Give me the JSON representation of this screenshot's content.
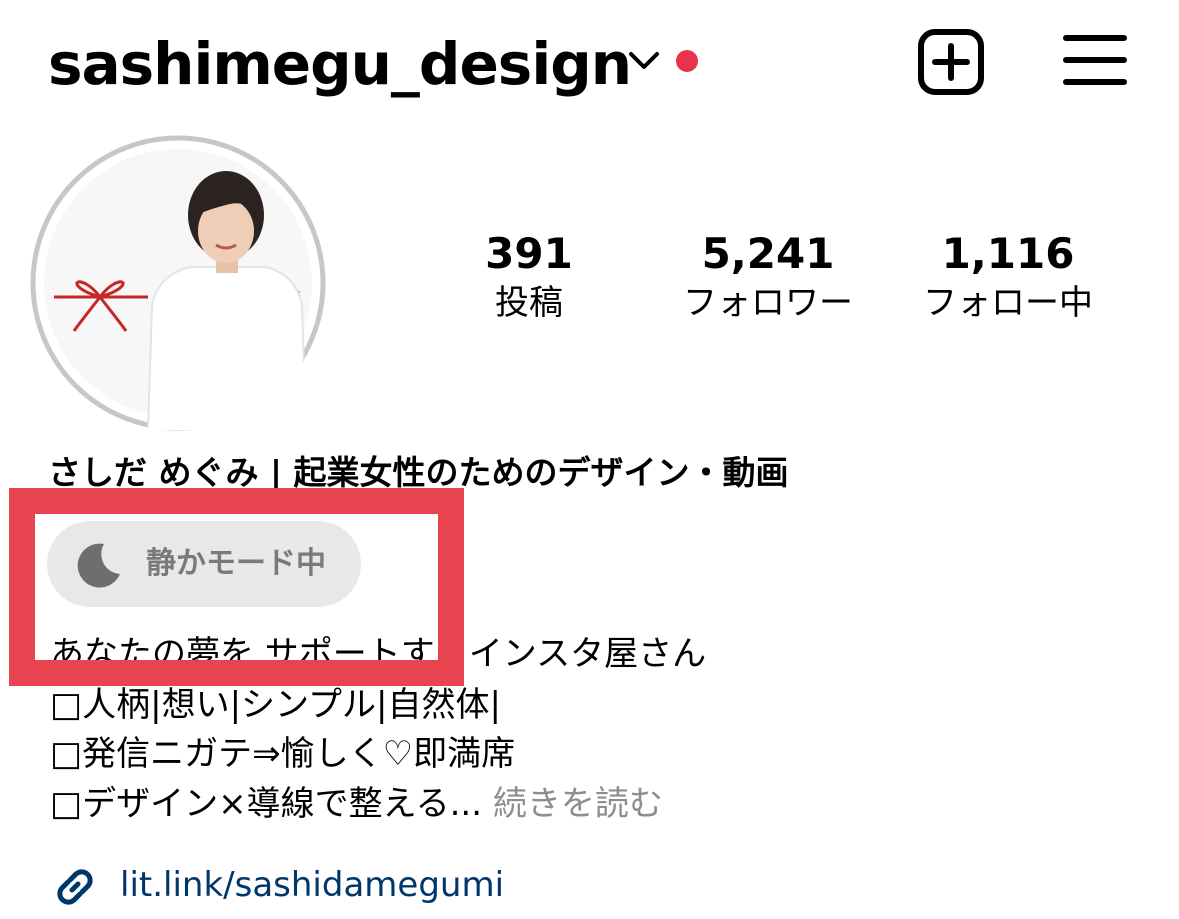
{
  "header": {
    "username": "sashimegu_design",
    "icons": {
      "dropdown": "chevron-down-icon",
      "notification": "notification-dot",
      "create": "plus-square-icon",
      "menu": "hamburger-menu-icon"
    }
  },
  "colors": {
    "notification_dot": "#e8334a",
    "highlight": "#e8444f",
    "link": "#00376b",
    "muted": "#8e8e8e"
  },
  "stats": [
    {
      "value": "391",
      "label": "投稿"
    },
    {
      "value": "5,241",
      "label": "フォロワー"
    },
    {
      "value": "1,116",
      "label": "フォロー中"
    }
  ],
  "bio": {
    "name": "さしだ めぐみ | 起業女性のためのデザイン・動画",
    "quiet_mode": {
      "label": "静かモード中",
      "icon": "moon-icon"
    },
    "lines": [
      "あなたの夢を  サポートするインスタ屋さん",
      "□人柄|想い|シンプル|自然体|",
      "□発信ニガテ⇒愉しく♡即満席"
    ],
    "last_line": "□デザイン×導線で整える...",
    "more": "続きを読む",
    "link": "lit.link/sashidamegumi",
    "link_icon": "link-icon"
  }
}
